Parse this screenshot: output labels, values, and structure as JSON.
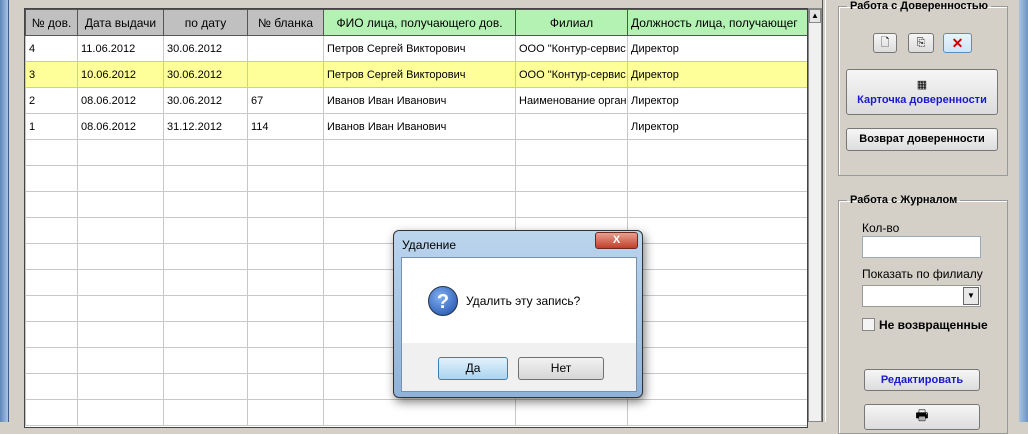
{
  "table": {
    "columns": [
      "№ дов.",
      "Дата выдачи",
      "по дату",
      "№ бланка",
      "ФИО лица, получающего дов.",
      "Филиал",
      "Должность лица, получающег"
    ],
    "rows": [
      [
        "4",
        "11.06.2012",
        "30.06.2012",
        "",
        "Петров Сергей Викторович",
        "ООО \"Контур-сервис",
        "Директор"
      ],
      [
        "3",
        "10.06.2012",
        "30.06.2012",
        "",
        "Петров Сергей Викторович",
        "ООО \"Контур-сервис",
        "Директор"
      ],
      [
        "2",
        "08.06.2012",
        "30.06.2012",
        "67",
        "Иванов Иван Иванович",
        "Наименование органі",
        "Лиректор"
      ],
      [
        "1",
        "08.06.2012",
        "31.12.2012",
        "114",
        "Иванов Иван Иванович",
        "",
        "Лиректор"
      ]
    ],
    "selected_row": 1
  },
  "panel": {
    "group1_title": "Работа с Доверенностью",
    "card_button": "Карточка доверенности",
    "return_button": "Возврат доверенности",
    "group2_title": "Работа с Журналом",
    "qty_label": "Кол-во",
    "qty_value": "",
    "branch_label": "Показать по филиалу",
    "branch_value": "",
    "not_returned_label": "Не возвращенные",
    "edit_button": "Редактировать"
  },
  "dialog": {
    "title": "Удаление",
    "message": "Удалить эту запись?",
    "yes": "Да",
    "no": "Нет"
  }
}
